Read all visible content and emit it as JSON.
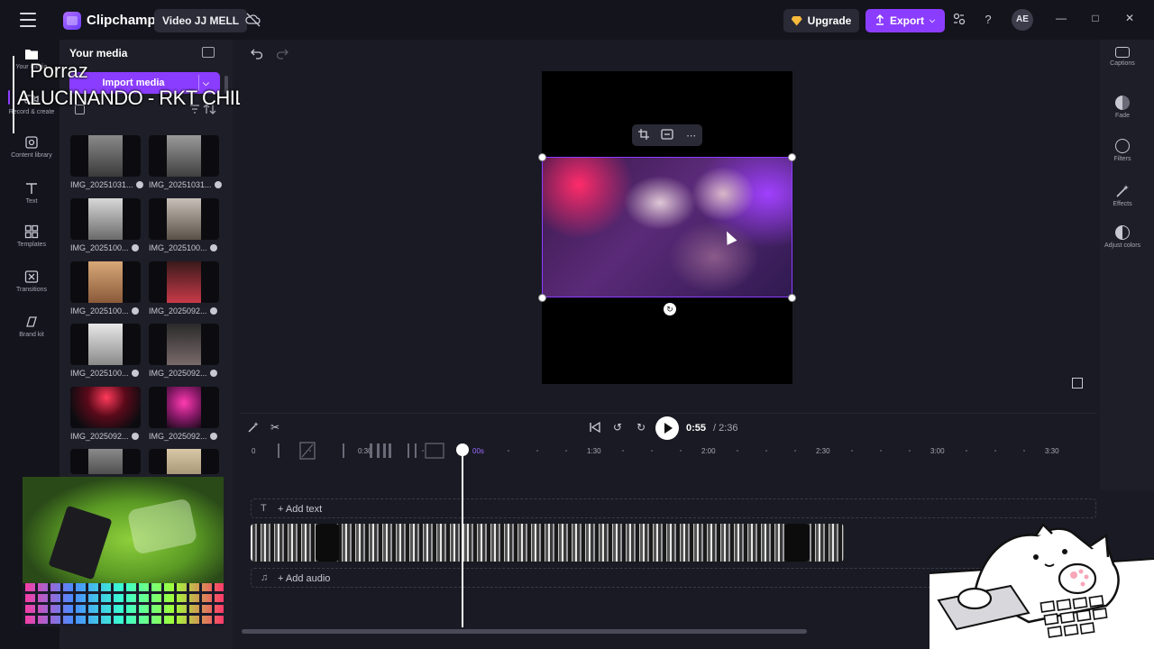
{
  "topbar": {
    "app_name": "Clipchamp",
    "project_title": "Video JJ MELL",
    "upgrade_label": "Upgrade",
    "export_label": "Export",
    "avatar_initials": "AE"
  },
  "rail": {
    "items": [
      {
        "label": "Your media"
      },
      {
        "label": "Record & create"
      },
      {
        "label": "Content library"
      },
      {
        "label": "Text"
      },
      {
        "label": "Templates"
      },
      {
        "label": "Transitions"
      },
      {
        "label": "Brand kit"
      }
    ]
  },
  "media": {
    "title": "Your media",
    "import_label": "Import media",
    "thumbnails": [
      {
        "label": "IMG_20251031..."
      },
      {
        "label": "IMG_20251031..."
      },
      {
        "label": "IMG_2025100..."
      },
      {
        "label": "IMG_2025100..."
      },
      {
        "label": "IMG_2025100..."
      },
      {
        "label": "IMG_2025092..."
      },
      {
        "label": "IMG_2025100..."
      },
      {
        "label": "IMG_2025092..."
      },
      {
        "label": "IMG_2025092..."
      },
      {
        "label": "IMG_2025092..."
      }
    ]
  },
  "overlay": {
    "artist": "Porraz",
    "song": "ALUCINANDO - RKT CHILL"
  },
  "right_panel": {
    "items": [
      {
        "label": "Captions"
      },
      {
        "label": "Fade"
      },
      {
        "label": "Filters"
      },
      {
        "label": "Effects"
      },
      {
        "label": "Adjust colors"
      }
    ]
  },
  "timeline": {
    "current_time": "0:55",
    "total_time": "/ 2:36",
    "playhead_label": "00s",
    "ruler": [
      "0",
      "0:30",
      "1:30",
      "2:00",
      "2:30",
      "3:00",
      "3:30"
    ],
    "add_text_label": "+ Add text",
    "add_audio_label": "+ Add audio"
  },
  "colors": {
    "accent": "#8b3dff",
    "background": "#1a1a24",
    "panel": "#1e1e28"
  }
}
